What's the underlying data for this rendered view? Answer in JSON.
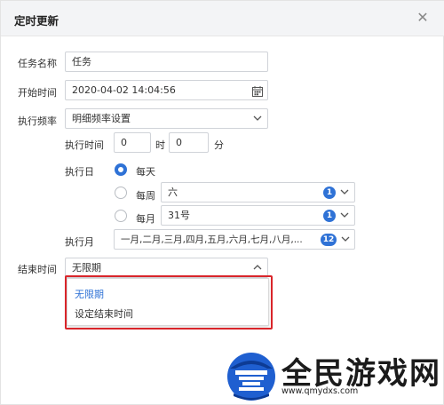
{
  "dialog": {
    "title": "定时更新",
    "close_glyph": "✕"
  },
  "form": {
    "task_name_label": "任务名称",
    "task_name_value": "任务",
    "start_time_label": "开始时间",
    "start_time_value": "2020-04-02 14:04:56",
    "frequency_label": "执行频率",
    "frequency_value": "明细频率设置",
    "exec_time_label": "执行时间",
    "exec_hour_value": "0",
    "hour_unit": "时",
    "exec_minute_value": "0",
    "minute_unit": "分",
    "exec_day_label": "执行日",
    "daily_label": "每天",
    "weekly_label": "每周",
    "weekly_value": "六",
    "weekly_count": "1",
    "monthly_label": "每月",
    "monthly_value": "31号",
    "monthly_count": "1",
    "exec_month_label": "执行月",
    "exec_month_value": "一月,二月,三月,四月,五月,六月,七月,八月,...",
    "exec_month_count": "12",
    "end_time_label": "结束时间",
    "end_time_value": "无限期"
  },
  "dropdown": {
    "options": [
      "无限期",
      "设定结束时间"
    ],
    "selected_color": "#2f72d6"
  },
  "watermark": {
    "brand": "全民游戏网",
    "url": "www.qmydxs.com"
  },
  "colors": {
    "accent": "#2f72d6",
    "highlight": "#d9252a"
  }
}
